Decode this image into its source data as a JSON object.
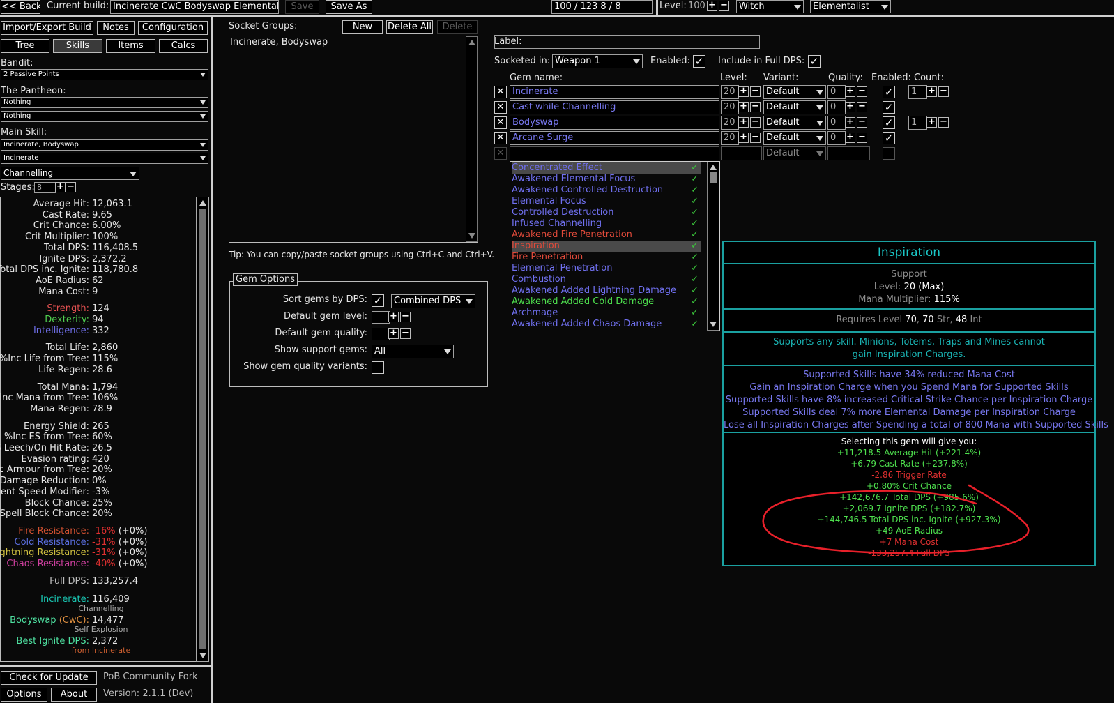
{
  "topbar": {
    "back_label": "<< Back",
    "current_build_label": "Current build:",
    "build_name": "Incinerate CwC Bodyswap Elementalist",
    "save_label": "Save",
    "save_as_label": "Save As",
    "points": "100  /  123     8  /  8",
    "level_label": "Level:",
    "level_value": "100",
    "class_name": "Witch",
    "ascendancy": "Elementalist"
  },
  "left_tabs": {
    "import_export": "Import/Export Build",
    "notes": "Notes",
    "configuration": "Configuration",
    "tree": "Tree",
    "skills": "Skills",
    "items": "Items",
    "calcs": "Calcs"
  },
  "config": {
    "bandit_label": "Bandit:",
    "bandit_value": "2 Passive Points",
    "pantheon_label": "The Pantheon:",
    "pantheon_major": "Nothing",
    "pantheon_minor": "Nothing",
    "main_skill_label": "Main Skill:",
    "main_skill_group": "Incinerate, Bodyswap",
    "main_skill_gem": "Incinerate",
    "skill_part": "Channelling",
    "stages_label": "Stages:",
    "stages_value": "8"
  },
  "stats": [
    {
      "k": "Average Hit:",
      "v": "12,063.1",
      "kc": "#e6e6e6"
    },
    {
      "k": "Cast Rate:",
      "v": "9.65",
      "kc": "#e6e6e6"
    },
    {
      "k": "Crit Chance:",
      "v": "6.00%",
      "kc": "#e6e6e6"
    },
    {
      "k": "Crit Multiplier:",
      "v": "100%",
      "kc": "#e6e6e6"
    },
    {
      "k": "Total DPS:",
      "v": "116,408.5",
      "kc": "#e6e6e6"
    },
    {
      "k": "Ignite DPS:",
      "v": "2,372.2",
      "kc": "#e6e6e6"
    },
    {
      "k": "Total DPS inc. Ignite:",
      "v": "118,780.8",
      "kc": "#e6e6e6"
    },
    {
      "k": "AoE Radius:",
      "v": "62",
      "kc": "#e6e6e6"
    },
    {
      "k": "Mana Cost:",
      "v": "9",
      "kc": "#e6e6e6"
    },
    {
      "k": "",
      "v": "",
      "kc": "#e6e6e6"
    },
    {
      "k": "Strength:",
      "v": "124",
      "kc": "#e05050"
    },
    {
      "k": "Dexterity:",
      "v": "94",
      "kc": "#50d050"
    },
    {
      "k": "Intelligence:",
      "v": "332",
      "kc": "#6e6ee6"
    },
    {
      "k": "",
      "v": "",
      "kc": "#e6e6e6"
    },
    {
      "k": "Total Life:",
      "v": "2,860",
      "kc": "#e6e6e6"
    },
    {
      "k": "%Inc Life from Tree:",
      "v": "115%",
      "kc": "#e6e6e6"
    },
    {
      "k": "Life Regen:",
      "v": "28.6",
      "kc": "#e6e6e6"
    },
    {
      "k": "",
      "v": "",
      "kc": "#e6e6e6"
    },
    {
      "k": "Total Mana:",
      "v": "1,794",
      "kc": "#e6e6e6"
    },
    {
      "k": "%Inc Mana from Tree:",
      "v": "106%",
      "kc": "#e6e6e6"
    },
    {
      "k": "Mana Regen:",
      "v": "78.9",
      "kc": "#e6e6e6"
    },
    {
      "k": "",
      "v": "",
      "kc": "#e6e6e6"
    },
    {
      "k": "Energy Shield:",
      "v": "265",
      "kc": "#e6e6e6"
    },
    {
      "k": "%Inc ES from Tree:",
      "v": "60%",
      "kc": "#e6e6e6"
    },
    {
      "k": "ES Leech/On Hit Rate:",
      "v": "26.5",
      "kc": "#e6e6e6"
    },
    {
      "k": "Evasion rating:",
      "v": "420",
      "kc": "#e6e6e6"
    },
    {
      "k": "%Inc Armour from Tree:",
      "v": "20%",
      "kc": "#e6e6e6"
    },
    {
      "k": "Phys. Damage Reduction:",
      "v": "0%",
      "kc": "#e6e6e6"
    },
    {
      "k": "Movement Speed Modifier:",
      "v": "-3%",
      "kc": "#e6e6e6"
    },
    {
      "k": "Block Chance:",
      "v": "25%",
      "kc": "#e6e6e6"
    },
    {
      "k": "Spell Block Chance:",
      "v": "20%",
      "kc": "#e6e6e6"
    }
  ],
  "resists": [
    {
      "k": "Fire Resistance:",
      "v": "-16%",
      "extra": "(+0%)",
      "kc": "#d05030"
    },
    {
      "k": "Cold Resistance:",
      "v": "-31%",
      "extra": "(+0%)",
      "kc": "#5a6ee0"
    },
    {
      "k": "Lightning Resistance:",
      "v": "-31%",
      "extra": "(+0%)",
      "kc": "#d0c040"
    },
    {
      "k": "Chaos Resistance:",
      "v": "-40%",
      "extra": "(+0%)",
      "kc": "#d040a0"
    }
  ],
  "full_dps": {
    "k": "Full DPS:",
    "v": "133,257.4"
  },
  "skill_breakdown": {
    "incinerate_k": "Incinerate:",
    "incinerate_v": "116,409",
    "incinerate_sub": "Channelling",
    "bodyswap_k": "Bodyswap",
    "bodyswap_cwc": "(CwC):",
    "bodyswap_v": "14,477",
    "bodyswap_sub": "Self Explosion",
    "best_ignite_k": "Best Ignite DPS:",
    "best_ignite_v": "2,372",
    "best_ignite_sub": "from Incinerate"
  },
  "bottom_left": {
    "check_update": "Check for Update",
    "fork_name": "PoB Community Fork",
    "options": "Options",
    "about": "About",
    "version": "Version: 2.1.1 (Dev)"
  },
  "socket_groups": {
    "label": "Socket Groups:",
    "new_label": "New",
    "delete_all_label": "Delete All",
    "delete_label": "Delete",
    "items": [
      "Incinerate, Bodyswap"
    ],
    "tip": "Tip: You can copy/paste socket groups using Ctrl+C and Ctrl+V."
  },
  "gem_options": {
    "title": "Gem Options",
    "sort_label": "Sort gems by DPS:",
    "sort_mode": "Combined DPS",
    "default_level_label": "Default gem level:",
    "default_quality_label": "Default gem quality:",
    "show_support_label": "Show support gems:",
    "show_support_value": "All",
    "show_quality_label": "Show gem quality variants:"
  },
  "group_editor": {
    "label_label": "Label:",
    "socketed_in_label": "Socketed in:",
    "socketed_in_value": "Weapon 1",
    "enabled_label": "Enabled:",
    "include_full_dps_label": "Include in Full DPS:",
    "col_gem_name": "Gem name:",
    "col_level": "Level:",
    "col_variant": "Variant:",
    "col_quality": "Quality:",
    "col_enabled": "Enabled:",
    "col_count": "Count:",
    "gems": [
      {
        "name": "Incinerate",
        "level": "20",
        "variant": "Default",
        "quality": "0",
        "count": "1"
      },
      {
        "name": "Cast while Channelling",
        "level": "20",
        "variant": "Default",
        "quality": "0",
        "count": ""
      },
      {
        "name": "Bodyswap",
        "level": "20",
        "variant": "Default",
        "quality": "0",
        "count": "1"
      },
      {
        "name": "Arcane Surge",
        "level": "20",
        "variant": "Default",
        "quality": "0",
        "count": ""
      }
    ],
    "empty_variant": "Default"
  },
  "gem_dropdown": [
    {
      "name": "Concentrated Effect",
      "color": "#7070f0"
    },
    {
      "name": "Awakened Elemental Focus",
      "color": "#7070f0"
    },
    {
      "name": "Awakened Controlled Destruction",
      "color": "#7070f0"
    },
    {
      "name": "Elemental Focus",
      "color": "#7070f0"
    },
    {
      "name": "Controlled Destruction",
      "color": "#7070f0"
    },
    {
      "name": "Infused Channelling",
      "color": "#7070f0"
    },
    {
      "name": "Awakened Fire Penetration",
      "color": "#e04a3a"
    },
    {
      "name": "Inspiration",
      "color": "#e04a3a"
    },
    {
      "name": "Fire Penetration",
      "color": "#e04a3a"
    },
    {
      "name": "Elemental Penetration",
      "color": "#7070f0"
    },
    {
      "name": "Combustion",
      "color": "#7070f0"
    },
    {
      "name": "Awakened Added Lightning Damage",
      "color": "#7070f0"
    },
    {
      "name": "Awakened Added Cold Damage",
      "color": "#4ee04e"
    },
    {
      "name": "Archmage",
      "color": "#7070f0"
    },
    {
      "name": "Awakened Added Chaos Damage",
      "color": "#7070f0"
    }
  ],
  "tooltip": {
    "title": "Inspiration",
    "type": "Support",
    "level_label": "Level:",
    "level_value": "20",
    "level_max": "(Max)",
    "mana_mult_label": "Mana Multiplier:",
    "mana_mult_value": "115%",
    "req_prefix": "Requires Level",
    "req_level": "70",
    "req_str": "70",
    "req_str_label": "Str,",
    "req_int": "48",
    "req_int_label": "Int",
    "desc": [
      "Supports any skill. Minions, Totems, Traps and Mines cannot",
      "gain Inspiration Charges."
    ],
    "mods": [
      "Supported Skills have 34% reduced Mana Cost",
      "Gain an Inspiration Charge when you Spend Mana for Supported Skills",
      "Supported Skills have 8% increased Critical Strike Chance per Inspiration Charge",
      "Supported Skills deal 7% more Elemental Damage per Inspiration Charge",
      "Lose all Inspiration Charges after Spending a total of 800 Mana with Supported Skills"
    ],
    "gain_header": "Selecting this gem will give you:",
    "gains": [
      {
        "text": "+11,218.5 Average Hit (+221.4%)",
        "color": "#4ee04e"
      },
      {
        "text": "+6.79 Cast Rate (+237.8%)",
        "color": "#4ee04e"
      },
      {
        "text": "-2.86 Trigger Rate",
        "color": "#e03030"
      },
      {
        "text": "+0.80% Crit Chance",
        "color": "#4ee04e"
      },
      {
        "text": "+142,676.7 Total DPS (+985.6%)",
        "color": "#4ee04e"
      },
      {
        "text": "+2,069.7 Ignite DPS (+182.7%)",
        "color": "#4ee04e"
      },
      {
        "text": "+144,746.5 Total DPS inc. Ignite (+927.3%)",
        "color": "#4ee04e"
      },
      {
        "text": "+49 AoE Radius",
        "color": "#4ee04e"
      },
      {
        "text": "+7 Mana Cost",
        "color": "#e03030"
      },
      {
        "text": "-133,257.4 Full DPS",
        "color": "#e03030"
      }
    ]
  },
  "colors": {
    "tooltip_border": "#1aa0a0",
    "tooltip_title": "#1ac8c8",
    "gem_blue": "#7070f0",
    "gem_red": "#e04a3a",
    "gem_green": "#4ee04e",
    "annotation_red": "#e8202a"
  }
}
